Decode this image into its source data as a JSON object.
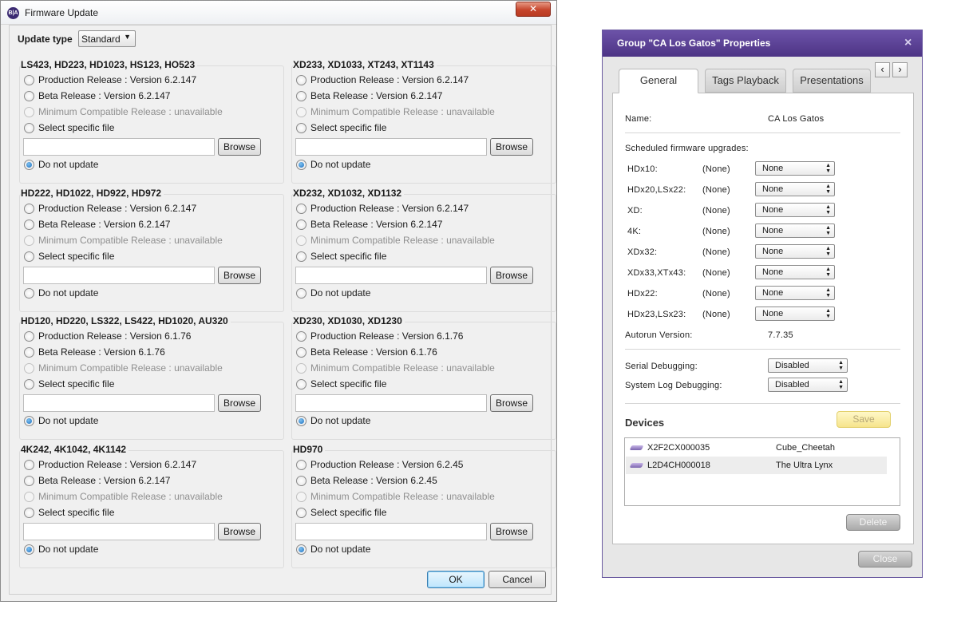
{
  "firmware_window": {
    "title": "Firmware Update",
    "app_icon_text": "B|A",
    "close_glyph": "✕",
    "update_type_label": "Update type",
    "update_type_value": "Standard",
    "browse_label": "Browse",
    "ok_label": "OK",
    "cancel_label": "Cancel",
    "groups": [
      {
        "title": "LS423, HD223, HD1023, HS123, HO523",
        "production": "Production Release : Version 6.2.147",
        "beta": "Beta Release : Version 6.2.147",
        "minimum": "Minimum Compatible Release : unavailable",
        "specific": "Select specific file",
        "file_value": "",
        "no_update": "Do not update",
        "selected": "no_update"
      },
      {
        "title": "XD233, XD1033, XT243, XT1143",
        "production": "Production Release : Version 6.2.147",
        "beta": "Beta Release : Version 6.2.147",
        "minimum": "Minimum Compatible Release : unavailable",
        "specific": "Select specific file",
        "file_value": "",
        "no_update": "Do not update",
        "selected": "no_update"
      },
      {
        "title": "HD222, HD1022, HD922, HD972",
        "production": "Production Release : Version 6.2.147",
        "beta": "Beta Release : Version 6.2.147",
        "minimum": "Minimum Compatible Release : unavailable",
        "specific": "Select specific file",
        "file_value": "",
        "no_update": "Do not update",
        "selected": "none"
      },
      {
        "title": "XD232, XD1032, XD1132",
        "production": "Production Release : Version 6.2.147",
        "beta": "Beta Release : Version 6.2.147",
        "minimum": "Minimum Compatible Release : unavailable",
        "specific": "Select specific file",
        "file_value": "",
        "no_update": "Do not update",
        "selected": "none"
      },
      {
        "title": "HD120, HD220, LS322, LS422, HD1020, AU320",
        "production": "Production Release : Version 6.1.76",
        "beta": "Beta Release : Version 6.1.76",
        "minimum": "Minimum Compatible Release : unavailable",
        "specific": "Select specific file",
        "file_value": "",
        "no_update": "Do not update",
        "selected": "no_update"
      },
      {
        "title": "XD230, XD1030, XD1230",
        "production": "Production Release : Version 6.1.76",
        "beta": "Beta Release : Version 6.1.76",
        "minimum": "Minimum Compatible Release : unavailable",
        "specific": "Select specific file",
        "file_value": "",
        "no_update": "Do not update",
        "selected": "no_update"
      },
      {
        "title": "4K242, 4K1042, 4K1142",
        "production": "Production Release : Version 6.2.147",
        "beta": "Beta Release : Version 6.2.147",
        "minimum": "Minimum Compatible Release : unavailable",
        "specific": "Select specific file",
        "file_value": "",
        "no_update": "Do not update",
        "selected": "no_update"
      },
      {
        "title": "HD970",
        "production": "Production Release : Version 6.2.45",
        "beta": "Beta Release : Version 6.2.45",
        "minimum": "Minimum Compatible Release : unavailable",
        "specific": "Select specific file",
        "file_value": "",
        "no_update": "Do not update",
        "selected": "no_update"
      }
    ]
  },
  "props_window": {
    "title": "Group \"CA Los Gatos\" Properties",
    "close_glyph": "×",
    "tabs": [
      "General",
      "Tags Playback",
      "Presentations"
    ],
    "active_tab": "General",
    "scroll_left_glyph": "‹",
    "scroll_right_glyph": "›",
    "name_label": "Name:",
    "name_value": "CA Los Gatos",
    "scheduled_label": "Scheduled firmware upgrades:",
    "upgrades": [
      {
        "model": "HDx10:",
        "current": "(None)",
        "value": "None"
      },
      {
        "model": "HDx20,LSx22:",
        "current": "(None)",
        "value": "None"
      },
      {
        "model": "XD:",
        "current": "(None)",
        "value": "None"
      },
      {
        "model": "4K:",
        "current": "(None)",
        "value": "None"
      },
      {
        "model": "XDx32:",
        "current": "(None)",
        "value": "None"
      },
      {
        "model": "XDx33,XTx43:",
        "current": "(None)",
        "value": "None"
      },
      {
        "model": "HDx22:",
        "current": "(None)",
        "value": "None"
      },
      {
        "model": "HDx23,LSx23:",
        "current": "(None)",
        "value": "None"
      }
    ],
    "autorun_label": "Autorun Version:",
    "autorun_value": "7.7.35",
    "serial_debug_label": "Serial Debugging:",
    "serial_debug_value": "Disabled",
    "syslog_debug_label": "System Log Debugging:",
    "syslog_debug_value": "Disabled",
    "devices_heading": "Devices",
    "save_label": "Save",
    "devices": [
      {
        "serial": "X2F2CX000035",
        "name": "Cube_Cheetah"
      },
      {
        "serial": "L2D4CH000018",
        "name": "The Ultra Lynx"
      }
    ],
    "delete_label": "Delete",
    "close_label": "Close"
  }
}
